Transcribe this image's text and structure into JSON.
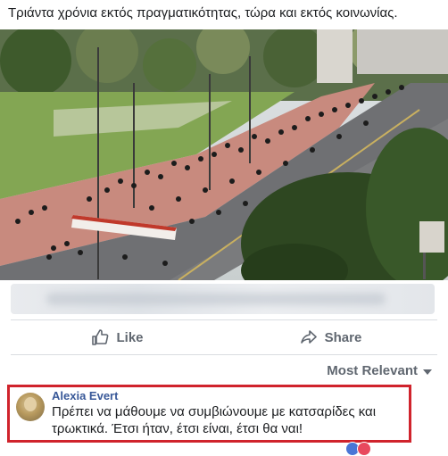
{
  "post": {
    "text": "Τριάντα χρόνια εκτός πραγματικότητας,  τώρα και εκτός κοινωνίας."
  },
  "photo": {
    "banner_text": "",
    "colors": {
      "sky": "#e6e8ea",
      "grass": "#7fa34a",
      "plaza": "#c98b80",
      "road": "#6c6c6c",
      "trees": "#2f4a22"
    }
  },
  "actions": {
    "like_label": "Like",
    "share_label": "Share"
  },
  "comments_sort": {
    "label": "Most Relevant"
  },
  "comment": {
    "author": "Alexia Evert",
    "text": "Πρέπει να μάθουμε να συμβιώνουμε με κατσαρίδες και τρωκτικά. Έτσι ήταν, έτσι είναι, έτσι θα ναι!",
    "highlight_color": "#d0232c"
  },
  "reaction_icons": [
    "like-reaction-icon",
    "love-reaction-icon"
  ]
}
